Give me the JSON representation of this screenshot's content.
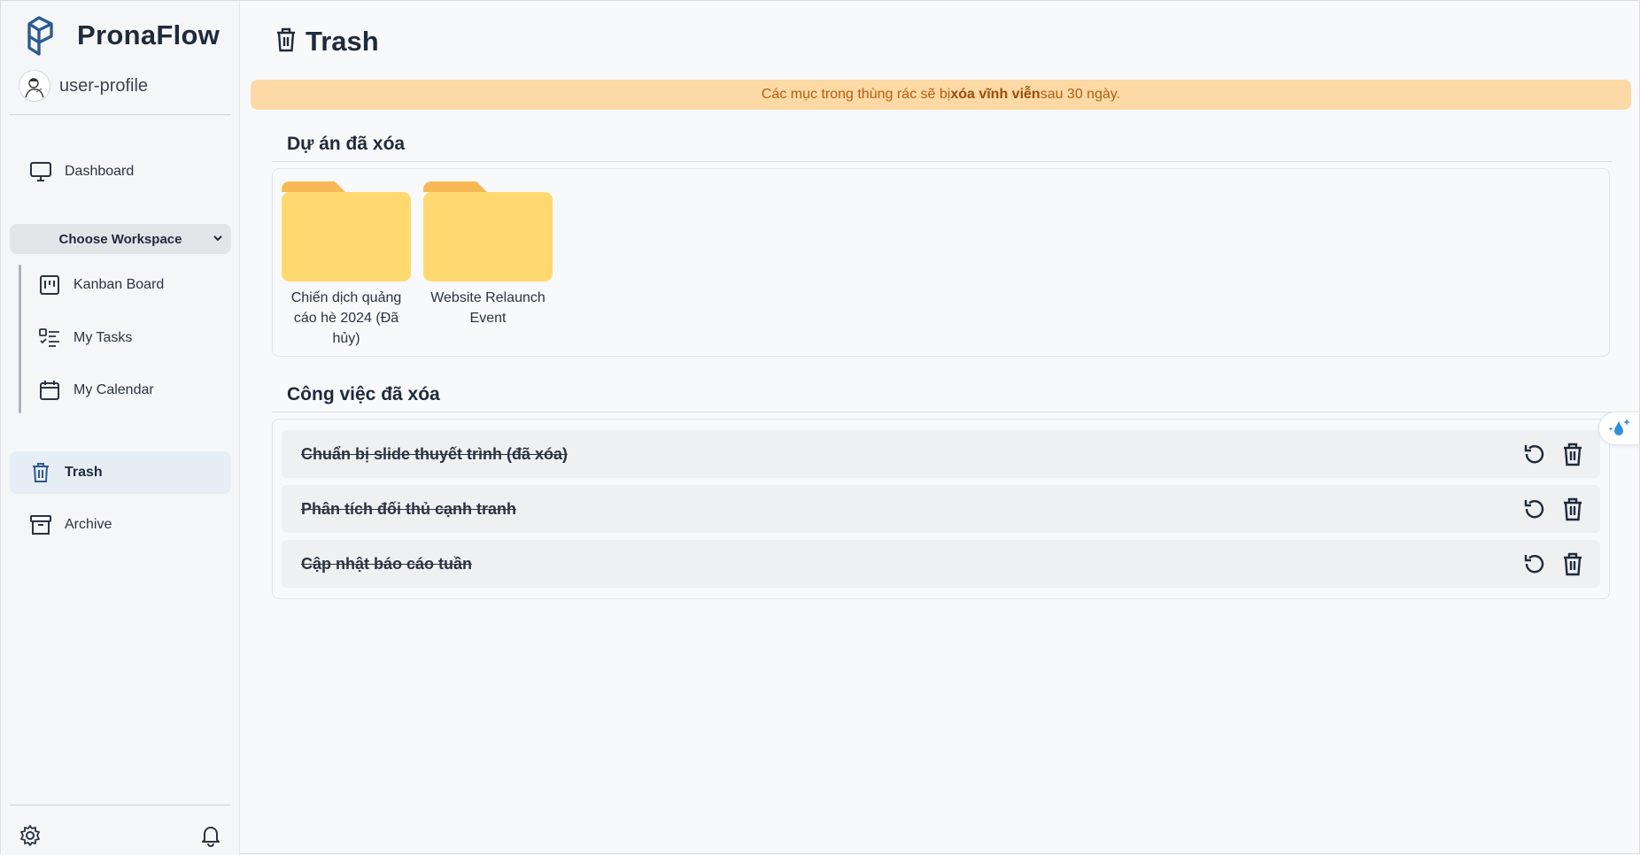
{
  "app": {
    "brand": "PronaFlow",
    "user": "user-profile"
  },
  "sidebar": {
    "dashboard": "Dashboard",
    "workspace_select": "Choose Workspace",
    "workspace_items": [
      {
        "label": "Kanban Board",
        "icon": "kanban-icon"
      },
      {
        "label": "My Tasks",
        "icon": "checklist-icon"
      },
      {
        "label": "My Calendar",
        "icon": "calendar-icon"
      }
    ],
    "trash": "Trash",
    "archive": "Archive",
    "footer_icons": [
      "gear-icon",
      "bell-icon"
    ]
  },
  "page": {
    "title": "Trash",
    "banner": {
      "prefix": "Các mục trong thùng rác sẽ bị",
      "bold": "xóa vĩnh viễn",
      "suffix": "sau 30 ngày."
    }
  },
  "deleted_projects": {
    "title": "Dự án đã xóa",
    "items": [
      {
        "name": "Chiến dịch quảng cáo hè 2024 (Đã hủy)"
      },
      {
        "name": "Website Relaunch Event"
      }
    ]
  },
  "deleted_tasks": {
    "title": "Công việc đã xóa",
    "items": [
      {
        "name": "Chuẩn bị slide thuyết trình (đã xóa)"
      },
      {
        "name": "Phân tích đối thủ cạnh tranh"
      },
      {
        "name": "Cập nhật báo cáo tuần"
      }
    ]
  },
  "colors": {
    "banner_bg": "#fdd9a6",
    "banner_text": "#b25f0b",
    "folder": "#ffd970",
    "folder_tab": "#f7b955",
    "accent": "#2c5a8f"
  }
}
